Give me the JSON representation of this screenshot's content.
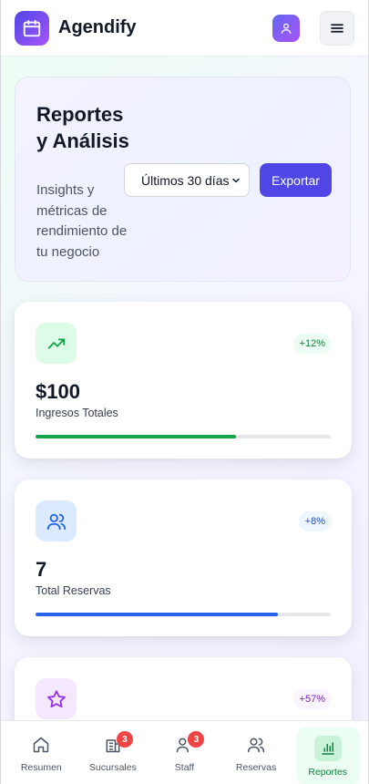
{
  "header": {
    "brand": "Agendify",
    "logo_icon": "calendar-icon",
    "user_icon": "user-icon",
    "menu_icon": "menu-icon"
  },
  "hero": {
    "title": "Reportes y Análisis",
    "subtitle": "Insights y métricas de rendimiento de tu negocio",
    "range_select": {
      "selected": "Últimos 30 días"
    },
    "export_label": "Exportar"
  },
  "metrics": [
    {
      "icon": "trending-up-icon",
      "badge": "+12%",
      "value": "$100",
      "label": "Ingresos Totales",
      "progress": 0.68,
      "accent": "#16a34a",
      "icon_bg": "#dcfce7",
      "badge_bg": "#ecfdf3",
      "badge_color": "#15803d"
    },
    {
      "icon": "users-icon",
      "badge": "+8%",
      "value": "7",
      "label": "Total Reservas",
      "progress": 0.82,
      "accent": "#2563eb",
      "icon_bg": "#dbeafe",
      "badge_bg": "#eff6ff",
      "badge_color": "#1d4ed8"
    },
    {
      "icon": "star-icon",
      "badge": "+57%",
      "value": "",
      "label": "",
      "progress": 0,
      "accent": "#9333ea",
      "icon_bg": "#f3e8ff",
      "badge_bg": "#faf5ff",
      "badge_color": "#7e22ce"
    }
  ],
  "nav": {
    "items": [
      {
        "label": "Resumen",
        "icon": "home-icon"
      },
      {
        "label": "Sucursales",
        "icon": "building-icon",
        "badge": "3"
      },
      {
        "label": "Staff",
        "icon": "user-icon",
        "badge": "3"
      },
      {
        "label": "Reservas",
        "icon": "users-icon"
      },
      {
        "label": "Reportes",
        "icon": "bar-chart-icon",
        "active": true
      }
    ]
  },
  "colors": {
    "primary": "#4f46e5",
    "success": "#16a34a",
    "info": "#2563eb",
    "purple": "#9333ea",
    "danger": "#ef4444"
  }
}
